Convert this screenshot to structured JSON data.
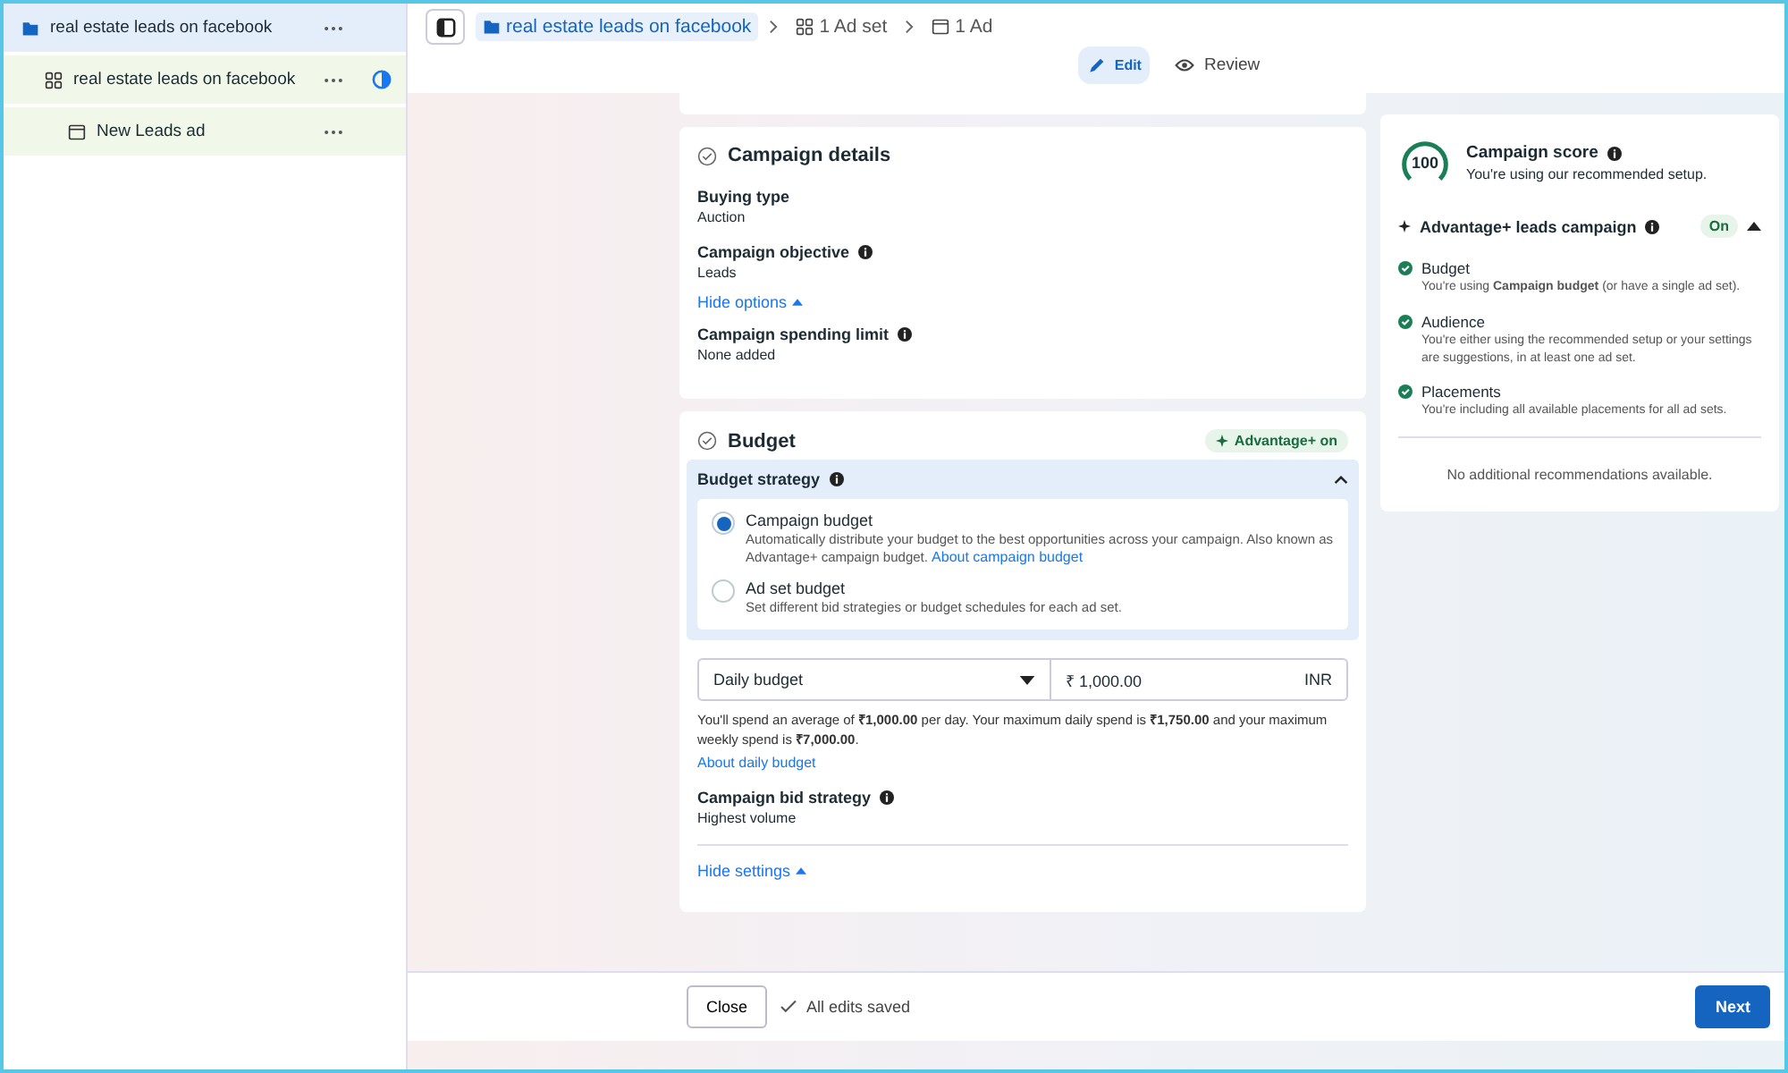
{
  "sidebar": {
    "tree": [
      {
        "kind": "campaign",
        "label": "real estate leads on facebook",
        "selected": true,
        "children": [
          {
            "kind": "adset",
            "label": "real estate leads on facebook",
            "selected": false,
            "children": [
              {
                "kind": "ad",
                "label": "New Leads ad",
                "selected": false
              }
            ]
          }
        ]
      }
    ]
  },
  "breadcrumb": [
    {
      "kind": "campaign",
      "label": "real estate leads on facebook",
      "selected": true
    },
    {
      "kind": "adset",
      "label": "1 Ad set",
      "selected": false
    },
    {
      "kind": "ad",
      "label": "1 Ad",
      "selected": false
    }
  ],
  "tabs": [
    {
      "kind": "edit",
      "label": "Edit",
      "selected": true
    },
    {
      "kind": "review",
      "label": "Review",
      "selected": false
    }
  ],
  "campaign_details": {
    "title": "Campaign details",
    "items": [
      {
        "kind": "field",
        "label": "Buying type",
        "info": false,
        "value": "Auction"
      },
      {
        "kind": "field",
        "label": "Campaign objective",
        "info": true,
        "value": "Leads"
      },
      {
        "kind": "link",
        "label": "Hide options"
      },
      {
        "kind": "field",
        "label": "Campaign spending limit",
        "info": true,
        "value": "None added"
      }
    ]
  },
  "budget": {
    "title": "Budget",
    "badge": "Advantage+ on",
    "strategy": {
      "title": "Budget strategy",
      "expanded": true,
      "options": [
        {
          "label": "Campaign budget",
          "description": "Automatically distribute your budget to the best opportunities across your campaign. Also known as Advantage+ campaign budget.",
          "link": "About campaign budget",
          "selected": true
        },
        {
          "label": "Ad set budget",
          "description": "Set different bid strategies or budget schedules for each ad set.",
          "selected": false
        }
      ]
    },
    "budget_type": "Daily budget",
    "amount": "₹ 1,000.00",
    "currency": "INR",
    "note": "You'll spend an average of **₹1,000.00** per day. Your maximum daily spend is **₹1,750.00** and your maximum weekly spend is **₹7,000.00**.",
    "note_link": "About daily budget",
    "bid_strategy": {
      "label": "Campaign bid strategy",
      "value": "Highest volume"
    },
    "settings_link": "Hide settings"
  },
  "score": {
    "value": "100",
    "title": "Campaign score",
    "subtitle": "You're using our recommended setup.",
    "advantage": {
      "label": "Advantage+ leads campaign",
      "badge": "On",
      "expanded": true
    },
    "checks": [
      {
        "title": "Budget",
        "description": "You're using **Campaign budget** (or have a single ad set)."
      },
      {
        "title": "Audience",
        "description": "You're either using the recommended setup or your settings are suggestions, in at least one ad set."
      },
      {
        "title": "Placements",
        "description": "You're including all available placements for all ad sets."
      }
    ],
    "footer": "No additional recommendations available."
  },
  "footer": {
    "close": "Close",
    "status": "All edits saved",
    "next": "Next"
  }
}
